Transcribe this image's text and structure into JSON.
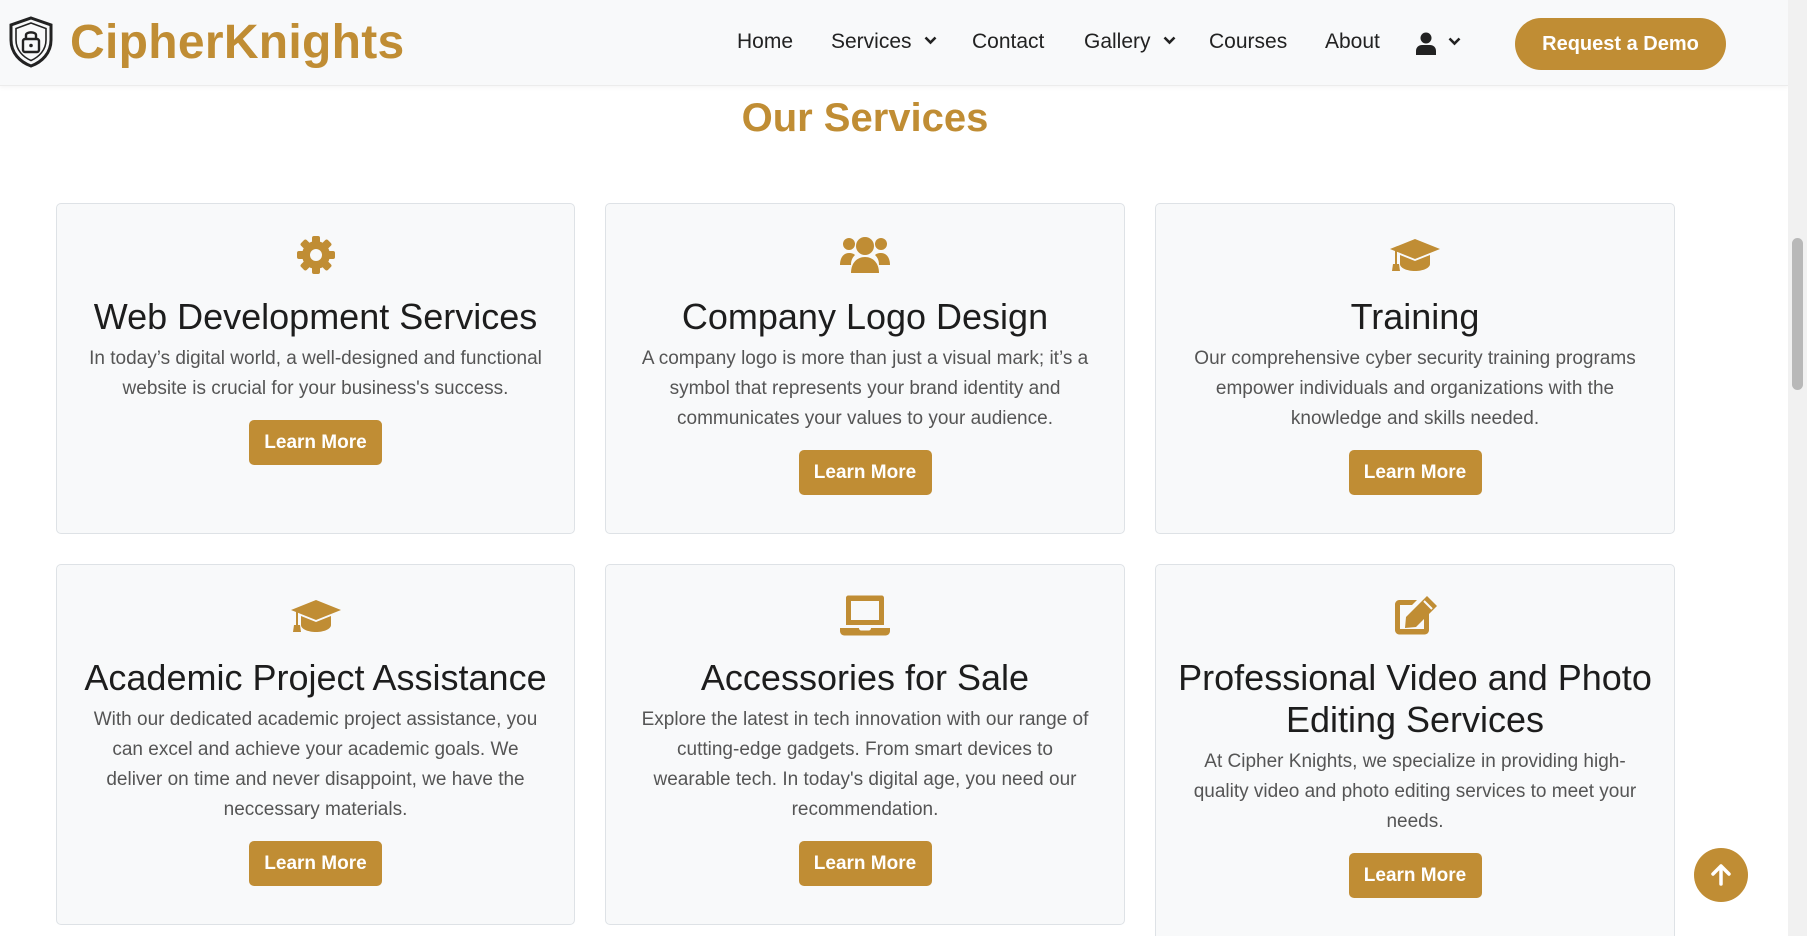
{
  "brand": {
    "name": "CipherKnights"
  },
  "nav": {
    "home": "Home",
    "services": "Services",
    "contact": "Contact",
    "gallery": "Gallery",
    "courses": "Courses",
    "about": "About",
    "demo_button": "Request a Demo"
  },
  "section": {
    "title": "Our Services"
  },
  "cards": [
    {
      "icon": "gear-icon",
      "title": "Web Development Services",
      "text": "In today’s digital world, a well-designed and functional website is crucial for your business's success.",
      "button": "Learn More"
    },
    {
      "icon": "users-icon",
      "title": "Company Logo Design",
      "text": "A company logo is more than just a visual mark; it’s a symbol that represents your brand identity and communicates your values to your audience.",
      "button": "Learn More"
    },
    {
      "icon": "graduation-cap-icon",
      "title": "Training",
      "text": "Our comprehensive cyber security training programs empower individuals and organizations with the knowledge and skills needed.",
      "button": "Learn More"
    },
    {
      "icon": "graduation-cap-icon",
      "title": "Academic Project Assistance",
      "text": "With our dedicated academic project assistance, you can excel and achieve your academic goals. We deliver on time and never disappoint, we have the neccessary materials.",
      "button": "Learn More"
    },
    {
      "icon": "laptop-icon",
      "title": "Accessories for Sale",
      "text": "Explore the latest in tech innovation with our range of cutting-edge gadgets. From smart devices to wearable tech. In today's digital age, you need our recommendation.",
      "button": "Learn More"
    },
    {
      "icon": "edit-icon",
      "title": "Professional Video and Photo Editing Services",
      "text": "At Cipher Knights, we specialize in providing high-quality video and photo editing services to meet your needs.",
      "button": "Learn More"
    }
  ],
  "colors": {
    "accent": "#c08d34",
    "card_bg": "#f8f9fa",
    "nav_bg": "#f8f9fa"
  }
}
